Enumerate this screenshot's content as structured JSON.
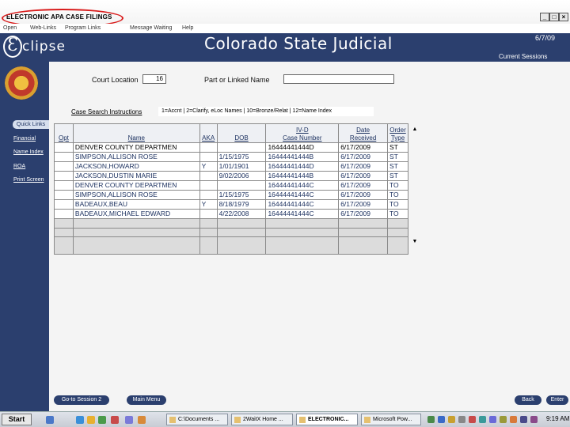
{
  "window": {
    "title": "ELECTRONIC APA CASE FILINGS",
    "minimize_label": "_",
    "maximize_label": "□",
    "close_label": "×"
  },
  "menubar": {
    "items": [
      "Open",
      "Web-Links",
      "Program Links",
      "Message Waiting",
      "Help"
    ]
  },
  "header": {
    "logo_letter": "Ɛ",
    "logo_word": "clipse",
    "title": "Colorado State Judicial",
    "date": "6/7/09",
    "session_link": "Current Sessions"
  },
  "sidebar": {
    "quick_links_label": "Quick Links",
    "items": [
      "Financial",
      "Name Index",
      "ROA",
      "Print Screen"
    ]
  },
  "search": {
    "court_label": "Court Location",
    "court_value": "16",
    "name_label": "Part or Linked Name",
    "name_value": "",
    "instructions_link": "Case Search Instructions",
    "legend": "1=Accnt | 2=Clarify, eLoc Names | 10=Bronze/Relat | 12=Name Index"
  },
  "table": {
    "headers": {
      "opt": "Opt",
      "name": "Name",
      "aka": "AKA",
      "dob": "DOB",
      "case_top": "IV-D",
      "case_bottom": "Case Number",
      "date_top": "Date",
      "date_bottom": "Received",
      "type_top": "Order",
      "type_bottom": "Type"
    },
    "rows": [
      {
        "opt": "",
        "name": "DENVER COUNTY DEPARTMEN",
        "aka": "",
        "dob": "",
        "case": "16444441444D",
        "date": "6/17/2009",
        "type": "ST"
      },
      {
        "opt": "",
        "name": "SIMPSON,ALLISON ROSE",
        "aka": "",
        "dob": "1/15/1975",
        "case": "16444441444B",
        "date": "6/17/2009",
        "type": "ST"
      },
      {
        "opt": "",
        "name": "JACKSON,HOWARD",
        "aka": "Y",
        "dob": "1/01/1901",
        "case": "16444441444D",
        "date": "6/17/2009",
        "type": "ST"
      },
      {
        "opt": "",
        "name": "JACKSON,DUSTIN MARIE",
        "aka": "",
        "dob": "9/02/2006",
        "case": "16444441444B",
        "date": "6/17/2009",
        "type": "ST"
      },
      {
        "opt": "",
        "name": "DENVER COUNTY DEPARTMEN",
        "aka": "",
        "dob": "",
        "case": "16444441444C",
        "date": "6/17/2009",
        "type": "TO"
      },
      {
        "opt": "",
        "name": "SIMPSON,ALLISON ROSE",
        "aka": "",
        "dob": "1/15/1975",
        "case": "16444441444C",
        "date": "6/17/2009",
        "type": "TO"
      },
      {
        "opt": "",
        "name": "BADEAUX,BEAU",
        "aka": "Y",
        "dob": "8/18/1979",
        "case": "16444441444C",
        "date": "6/17/2009",
        "type": "TO"
      },
      {
        "opt": "",
        "name": "BADEAUX,MICHAEL EDWARD",
        "aka": "",
        "dob": "4/22/2008",
        "case": "16444441444C",
        "date": "6/17/2009",
        "type": "TO"
      }
    ],
    "scroll_up": "▲",
    "scroll_down": "▼"
  },
  "buttons": {
    "go_to_session": "Go-to Session 2",
    "main_menu": "Main Menu",
    "back": "Back",
    "enter": "Enter"
  },
  "taskbar": {
    "start": "Start",
    "tasks": [
      "C:\\Documents ...",
      "2WaitX Home ...",
      "ELECTRONIC...",
      "Microsoft Pow..."
    ],
    "clock": "9:19 AM"
  }
}
